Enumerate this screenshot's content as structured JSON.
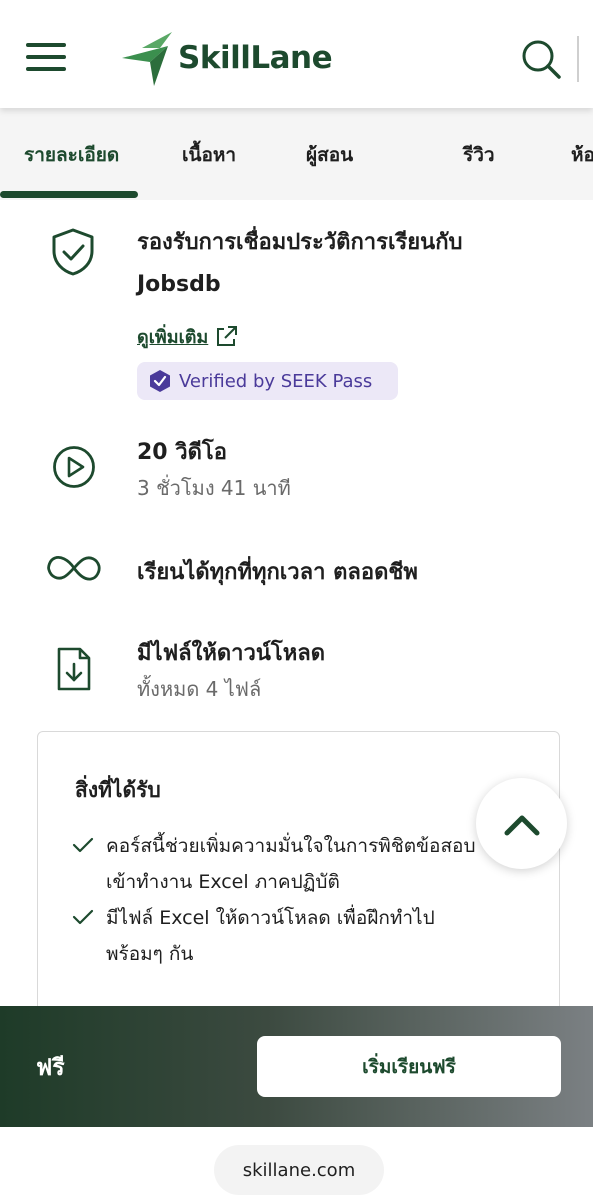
{
  "header": {
    "logo_text": "SkillLane"
  },
  "tabs": [
    {
      "label": "รายละเอียด",
      "active": true
    },
    {
      "label": "เนื้อหา",
      "active": false
    },
    {
      "label": "ผู้สอน",
      "active": false
    },
    {
      "label": "รีวิว",
      "active": false
    },
    {
      "label": "ห้อ",
      "active": false
    }
  ],
  "features": {
    "jobsdb": {
      "title_line1": "รองรับการเชื่อมประวัติการเรียนกับ",
      "title_line2": "Jobsdb",
      "more_link": "ดูเพิ่มเติม",
      "badge": "Verified by SEEK Pass",
      "icon": "shield-check-icon"
    },
    "videos": {
      "title": "20 วิดีโอ",
      "sub": "3 ชั่วโมง 41 นาที",
      "icon": "play-circle-icon"
    },
    "lifetime": {
      "title": "เรียนได้ทุกที่ทุกเวลา ตลอดชีพ",
      "icon": "infinity-icon"
    },
    "downloads": {
      "title": "มีไฟล์ให้ดาวน์โหลด",
      "sub": "ทั้งหมด 4 ไฟล์",
      "icon": "file-download-icon"
    }
  },
  "benefits": {
    "title": "สิ่งที่ได้รับ",
    "items": [
      {
        "line1": "คอร์สนี้ช่วยเพิ่มความมั่นใจในการพิชิตข้อสอบ",
        "line2": "เข้าทำงาน Excel ภาคปฏิบัติ"
      },
      {
        "line1": "มีไฟล์ Excel ให้ดาวน์โหลด เพื่อฝึกทำไป",
        "line2": "พร้อมๆ กัน"
      }
    ]
  },
  "bottom_bar": {
    "price": "ฟรี",
    "cta": "เริ่มเรียนฟรี"
  },
  "browser": {
    "url": "skillane.com"
  },
  "colors": {
    "brand_green": "#1d4a2e",
    "badge_bg": "#ece8f7",
    "badge_text": "#4a3a9a"
  }
}
